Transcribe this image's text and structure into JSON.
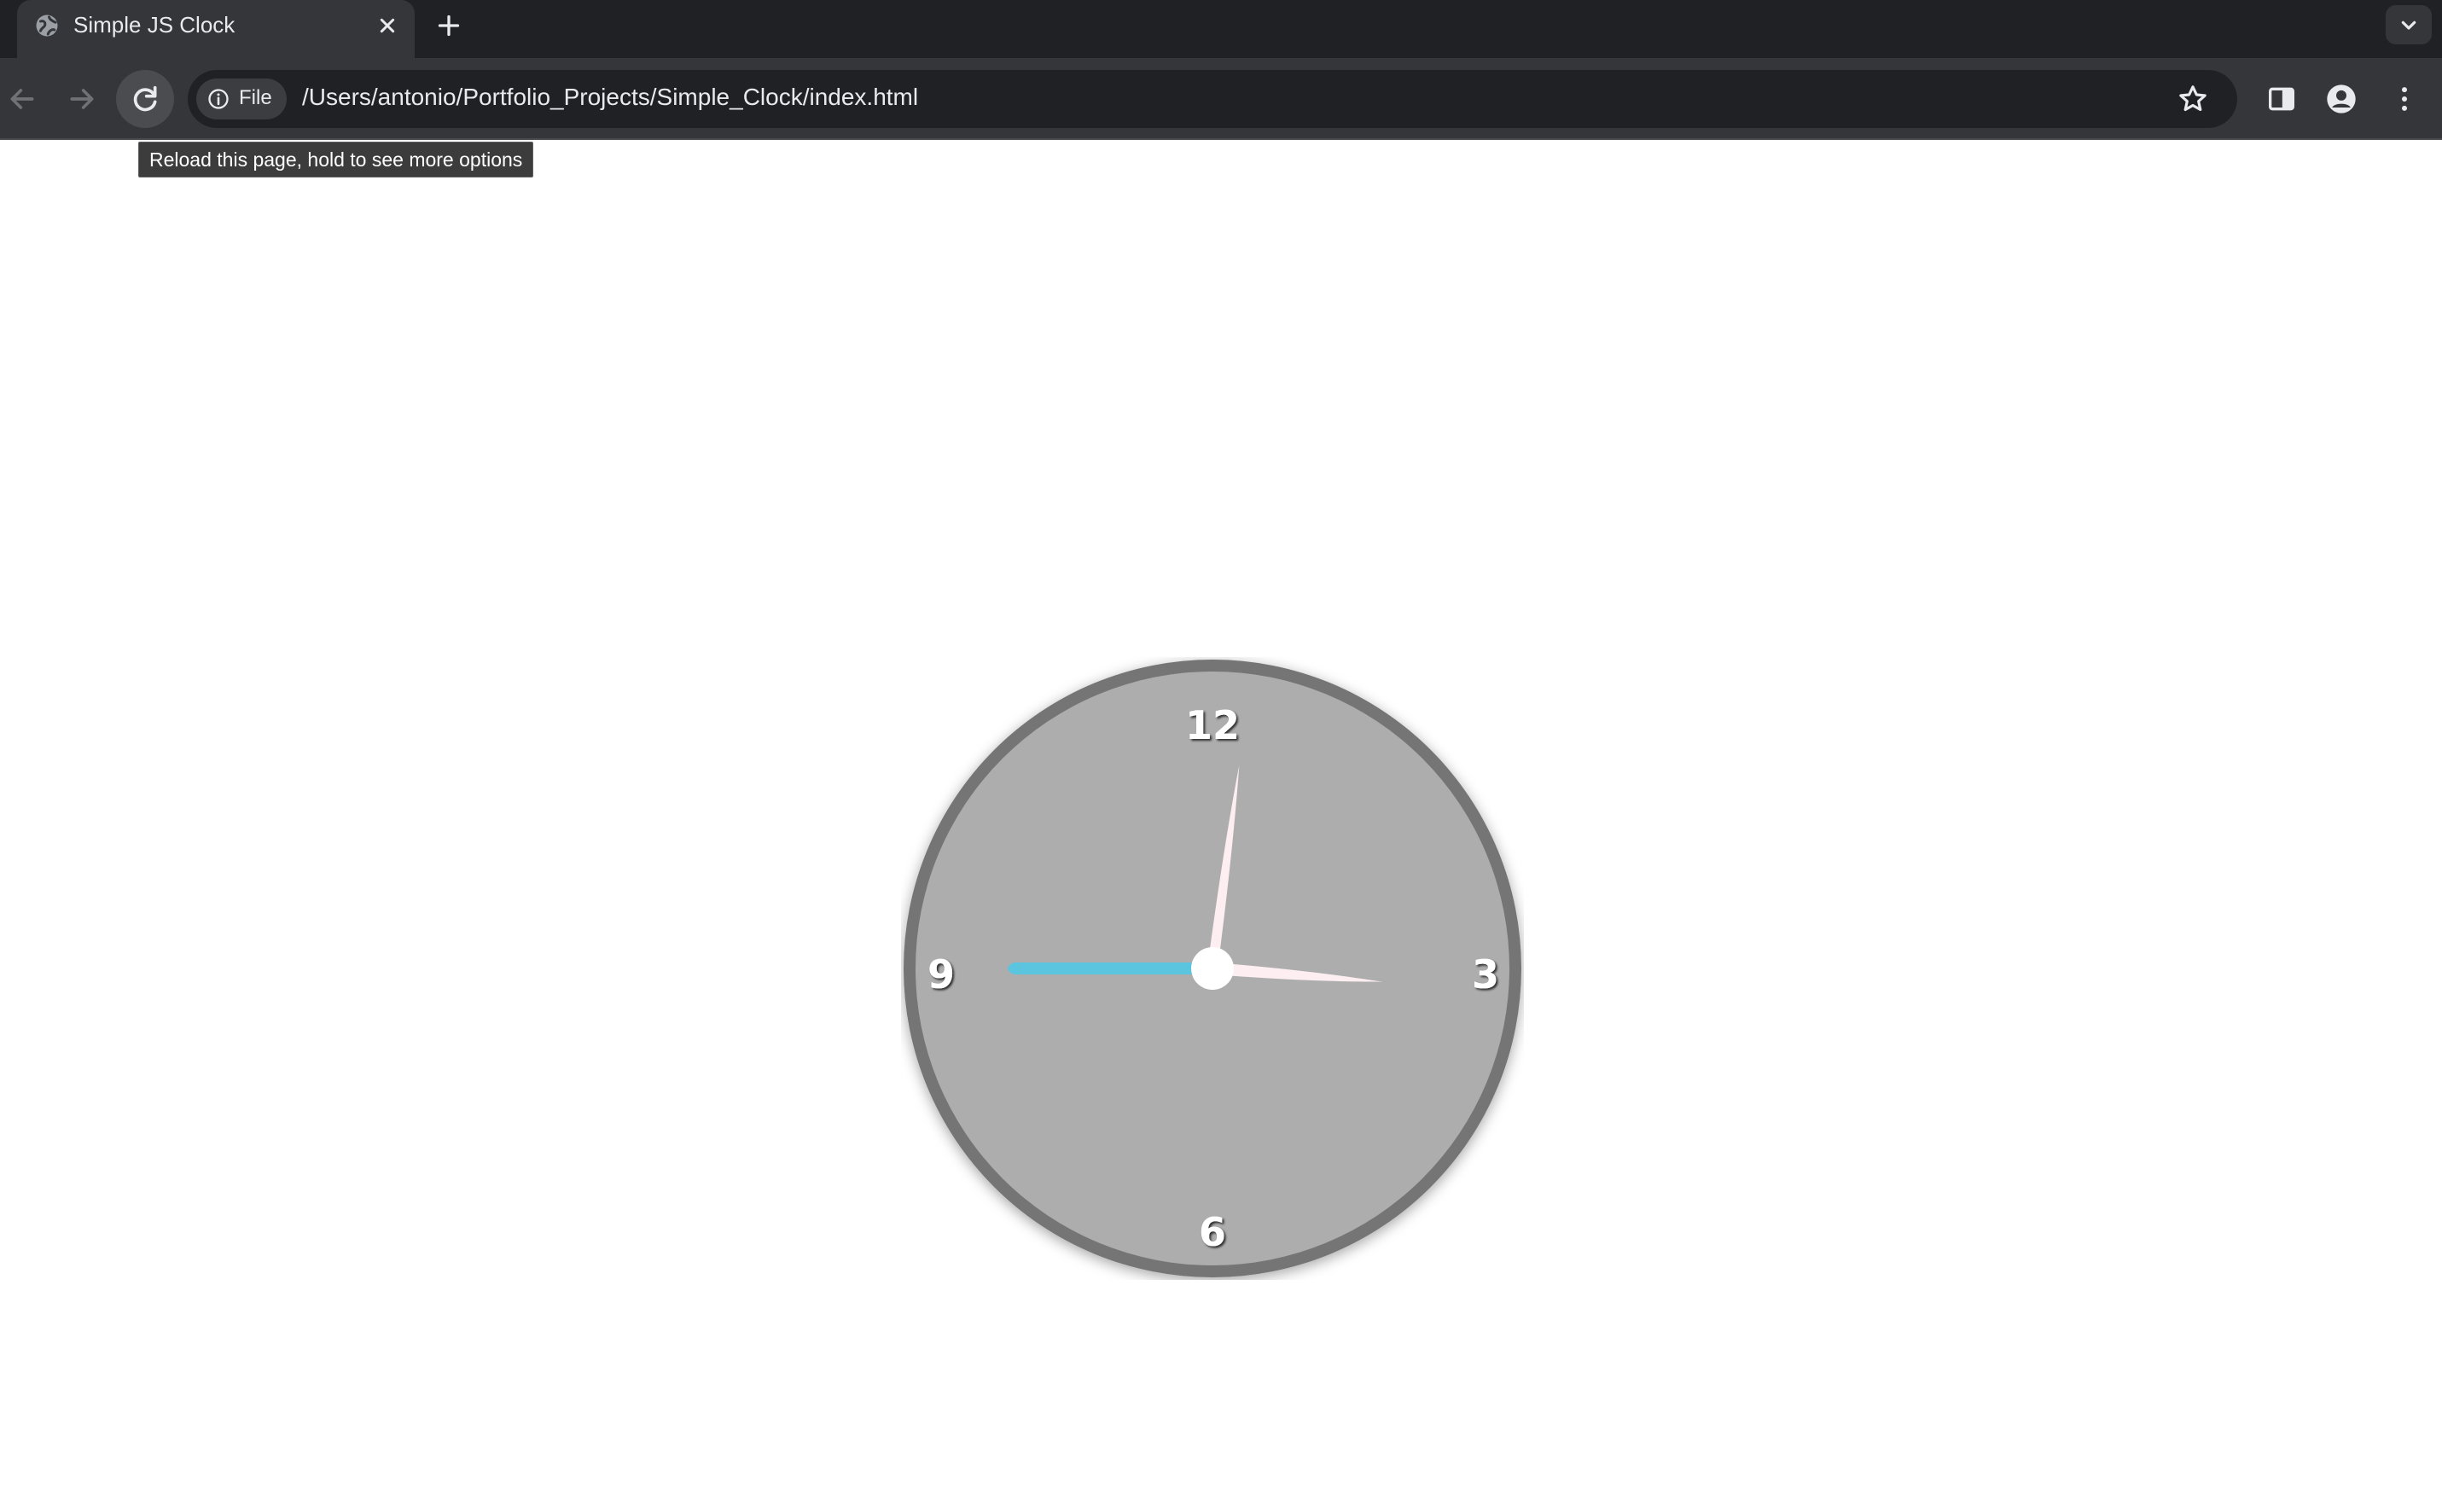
{
  "browser": {
    "tab": {
      "title": "Simple JS Clock",
      "favicon": "globe-icon",
      "close_icon": "close-icon"
    },
    "new_tab_icon": "plus-icon",
    "tab_search_icon": "chevron-down-icon",
    "toolbar": {
      "back_icon": "arrow-left-icon",
      "forward_icon": "arrow-right-icon",
      "reload_icon": "reload-icon",
      "site_info": {
        "icon": "info-icon",
        "label": "File"
      },
      "url": "/Users/antonio/Portfolio_Projects/Simple_Clock/index.html",
      "bookmark_icon": "star-icon",
      "side_panel_icon": "side-panel-icon",
      "profile_icon": "person-icon",
      "menu_icon": "kebab-menu-icon"
    },
    "tooltip": "Reload this page, hold to see more options"
  },
  "page": {
    "clock": {
      "numerals": {
        "twelve": "12",
        "three": "3",
        "six": "6",
        "nine": "9"
      },
      "time": {
        "hours": 12,
        "minutes": 15,
        "seconds": 45
      },
      "colors": {
        "face": "#adadad",
        "rim": "#757575",
        "hour_minute_hands": "#fdeef1",
        "second_hand": "#5bc4de",
        "center_pin": "#ffffff",
        "numerals": "#ffffff"
      }
    }
  }
}
